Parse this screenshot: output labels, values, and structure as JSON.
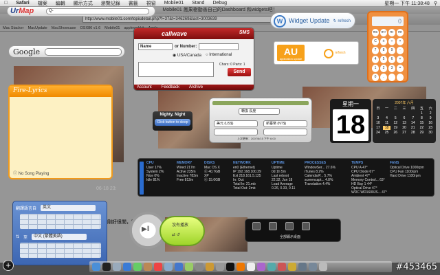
{
  "menubar": {
    "app": "Safari",
    "items": [
      "檔案",
      "編輯",
      "顯示方式",
      "瀏覽記錄",
      "書籤",
      "視窗",
      "Mobile01",
      "Stand",
      "Debug"
    ],
    "clock": "星期一 下午 11:38:48"
  },
  "browser": {
    "title": "Mobile01 瘋果樹動善自己的Dashboard 和widgets吧！",
    "url": "http://www.mobile01.com/topicdetail.php?f=37&t=346269&last=3003639",
    "bookmarks": [
      "Mac Stacker",
      "MacUpdate",
      "MacShowcase",
      "OSX86 v1.6",
      "Mobile01",
      "applewebkit",
      "Apple"
    ],
    "page_text": "剛好很閒，貼一下我的widgets給大家看看。",
    "page_text2": "06-18 23:"
  },
  "urmap": {
    "logo_a": "Ur",
    "logo_b": "Map",
    "placeholder": "Q-"
  },
  "google": {
    "logo": "Google"
  },
  "firelyrics": {
    "title": "Fire-Lyrics",
    "status": "No Song Playing"
  },
  "callwave": {
    "brand": "callwave",
    "sms": "SMS",
    "select": "Name",
    "number_label": "or Number:",
    "radio1": "USA/Canada",
    "radio2": "International",
    "chars": "Chars: 0   Parts: 1",
    "send": "Send",
    "footer": [
      "Account",
      "Feedback",
      "Archive"
    ]
  },
  "nighty": {
    "title": "Nighty, Night",
    "button": "Click button to sleep"
  },
  "widget_update": {
    "title": "Widget Update",
    "refresh": "refresh"
  },
  "app_update": {
    "logo": "AU",
    "sub": "application update",
    "refresh": "refresh"
  },
  "calculator": {
    "display": "0",
    "keys": [
      "mc",
      "m+",
      "m-",
      "mr",
      "C",
      "±",
      "÷",
      "×",
      "7",
      "8",
      "9",
      "-",
      "4",
      "5",
      "6",
      "+",
      "1",
      "2",
      "3",
      "=",
      "0",
      ".",
      "",
      ""
    ]
  },
  "translate1": {
    "from": "轉換",
    "from_sel": "長度",
    "a": "美元 (US$)",
    "b": "新臺幣 (NT$)",
    "footer": "上次更新：2007/6/15 下午 6:00"
  },
  "calendar": {
    "weekday": "星期一",
    "day": "18",
    "month_title": "2007年 六月",
    "heads": [
      "日",
      "一",
      "二",
      "三",
      "四",
      "五",
      "六"
    ],
    "cells": [
      "",
      "",
      "",
      "",
      "",
      "1",
      "2",
      "3",
      "4",
      "5",
      "6",
      "7",
      "8",
      "9",
      "10",
      "11",
      "12",
      "13",
      "14",
      "15",
      "16",
      "17",
      "18",
      "19",
      "20",
      "21",
      "22",
      "23",
      "24",
      "25",
      "26",
      "27",
      "28",
      "29",
      "30"
    ],
    "today_index": 22
  },
  "istat": {
    "cpu": {
      "h": "CPU",
      "l": [
        "User 17%",
        "System 2%",
        "Nice 0%",
        "Idle 81%"
      ]
    },
    "memory": {
      "h": "MEMORY",
      "l": [
        "Wired 217m",
        "Active 235m",
        "Inactive 783m",
        "Free 812m"
      ]
    },
    "disks": {
      "h": "DISKS",
      "l": [
        "Mac OS X",
        "Ⓧ 40.7GB",
        "XP",
        "Ⓧ 15.0GB"
      ]
    },
    "network": {
      "h": "NETWORK",
      "l": [
        "en0 (Ethernet)",
        "IP 192.168.100.29",
        "Ext 218.161.5.125",
        "In: Out:",
        "Total In: 21.mb",
        "Total Out: 2mb"
      ]
    },
    "uptime": {
      "h": "UPTIME",
      "l": [
        "Uptime",
        "0d 1h 5m",
        "Last reboot",
        "22:32, Jun 18",
        "Load Average",
        "0.26, 0.33, 0.11"
      ]
    },
    "processes": {
      "h": "PROCESSES",
      "l": [
        "WindowSer... 27.6%",
        "iTunes 8.2%",
        "CalendarP... 5.7%",
        "screencapt... 4.8%",
        "Translation 4.4%"
      ]
    },
    "temps": {
      "h": "TEMPS",
      "l": [
        "CPU A 47°",
        "CPU Diode 67°",
        "Ambient 47°",
        "Memory Control... 63°",
        "HD Bay 1 44°",
        "Optical Drive 47°",
        "WDC WD1600JS... 47°"
      ]
    },
    "fans": {
      "h": "FANS",
      "l": [
        "Optical Drive 1000rpm",
        "CPU Fan 1100rpm",
        "Hard Drive 1100rpm"
      ]
    }
  },
  "translate2": {
    "label1": "翻譯語言自",
    "sel1": "英文",
    "label2": "至",
    "sel2": "中文 (繁體美語)"
  },
  "ipod": {
    "title": "沒有播放",
    "controls": "⇄  ↺"
  },
  "spaces": {
    "label": "全部顯示桌面"
  },
  "add_button": "+",
  "watermark": "#453465",
  "colors": {
    "callwave_red": "#9a0e0e",
    "firelyrics_orange": "#f29a1a",
    "calculator_orange": "#f09040",
    "istat_blue": "#2a6cd0"
  }
}
